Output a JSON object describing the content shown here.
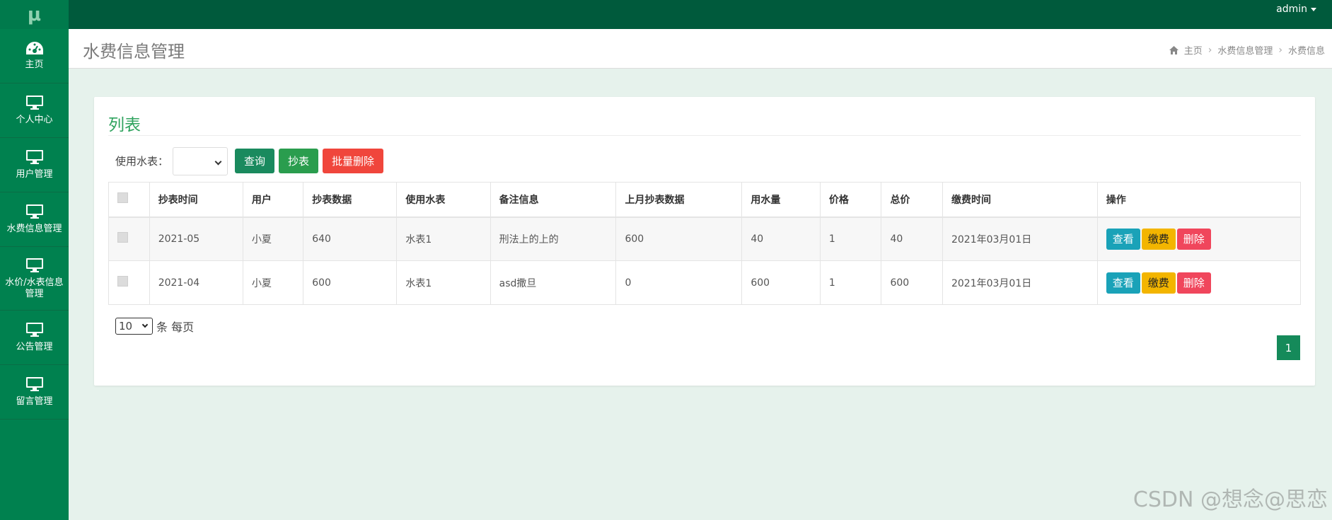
{
  "header": {
    "logo": "μ",
    "user": "admin"
  },
  "sidebar": {
    "items": [
      {
        "label": "主页",
        "icon": "dashboard-icon"
      },
      {
        "label": "个人中心",
        "icon": "monitor-icon"
      },
      {
        "label": "用户管理",
        "icon": "monitor-icon"
      },
      {
        "label": "水费信息管理",
        "icon": "monitor-icon"
      },
      {
        "label": "水价/水表信息管理",
        "icon": "monitor-icon"
      },
      {
        "label": "公告管理",
        "icon": "monitor-icon"
      },
      {
        "label": "留言管理",
        "icon": "monitor-icon"
      }
    ]
  },
  "page": {
    "title": "水费信息管理",
    "breadcrumb": [
      "主页",
      "水费信息管理",
      "水费信息"
    ]
  },
  "card": {
    "title": "列表",
    "filter_label": "使用水表：",
    "buttons": {
      "query": "查询",
      "read": "抄表",
      "batch_delete": "批量删除"
    }
  },
  "table": {
    "columns": [
      "抄表时间",
      "用户",
      "抄表数据",
      "使用水表",
      "备注信息",
      "上月抄表数据",
      "用水量",
      "价格",
      "总价",
      "缴费时间",
      "操作"
    ],
    "rows": [
      [
        "2021-05",
        "小夏",
        "640",
        "水表1",
        "刑法上的上的",
        "600",
        "40",
        "1",
        "40",
        "2021年03月01日"
      ],
      [
        "2021-04",
        "小夏",
        "600",
        "水表1",
        "asd撒旦",
        "0",
        "600",
        "1",
        "600",
        "2021年03月01日"
      ]
    ],
    "actions": {
      "view": "查看",
      "pay": "缴费",
      "delete": "删除"
    }
  },
  "pagination": {
    "page_size": "10",
    "page_size_suffix": "条 每页",
    "current_page": "1"
  },
  "watermark": "CSDN @想念@思恋",
  "colors": {
    "topbar": "#005a3c",
    "sidebar": "#00814f",
    "accent": "#2fa35e"
  }
}
